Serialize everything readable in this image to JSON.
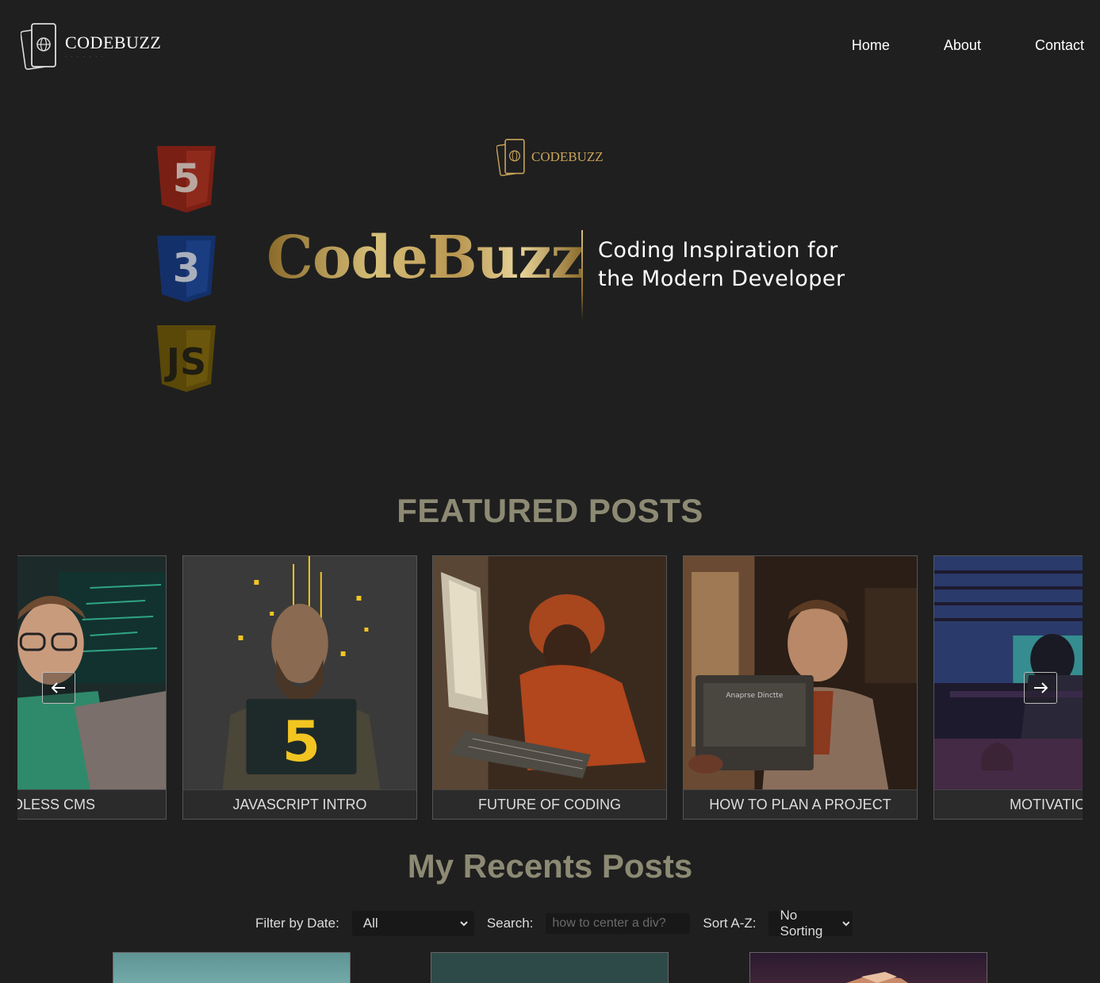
{
  "nav": {
    "logo_text": "CODEBUZZ",
    "links": [
      "Home",
      "About",
      "Contact"
    ]
  },
  "hero": {
    "mini_logo_text": "CODEBUZZ",
    "title": "CodeBuzz",
    "tagline_line1": "Coding Inspiration for",
    "tagline_line2": "the Modern Developer",
    "badges": [
      "html5-badge",
      "css3-badge",
      "js-badge"
    ]
  },
  "featured": {
    "title": "FEATURED POSTS",
    "cards": [
      {
        "label": "ADLESS CMS",
        "image": "developer-with-glasses-at-laptop"
      },
      {
        "label": "JAVASCRIPT INTRO",
        "image": "bearded-man-with-js-laptop"
      },
      {
        "label": "FUTURE OF CODING",
        "image": "child-typing-on-keyboard"
      },
      {
        "label": "HOW TO PLAN A PROJECT",
        "image": "man-reading-at-window"
      },
      {
        "label": "MOTIVATIO",
        "image": "coder-at-desk-with-cat"
      }
    ]
  },
  "recent": {
    "title": "My Recents Posts",
    "filter_label": "Filter by Date:",
    "filter_value": "All",
    "search_label": "Search:",
    "search_placeholder": "how to center a div?",
    "sort_label": "Sort A-Z:",
    "sort_value": "No Sorting"
  },
  "colors": {
    "background": "#1f1f1f",
    "accent_gold": "#c9a45a",
    "section_title": "#8d8a74"
  }
}
